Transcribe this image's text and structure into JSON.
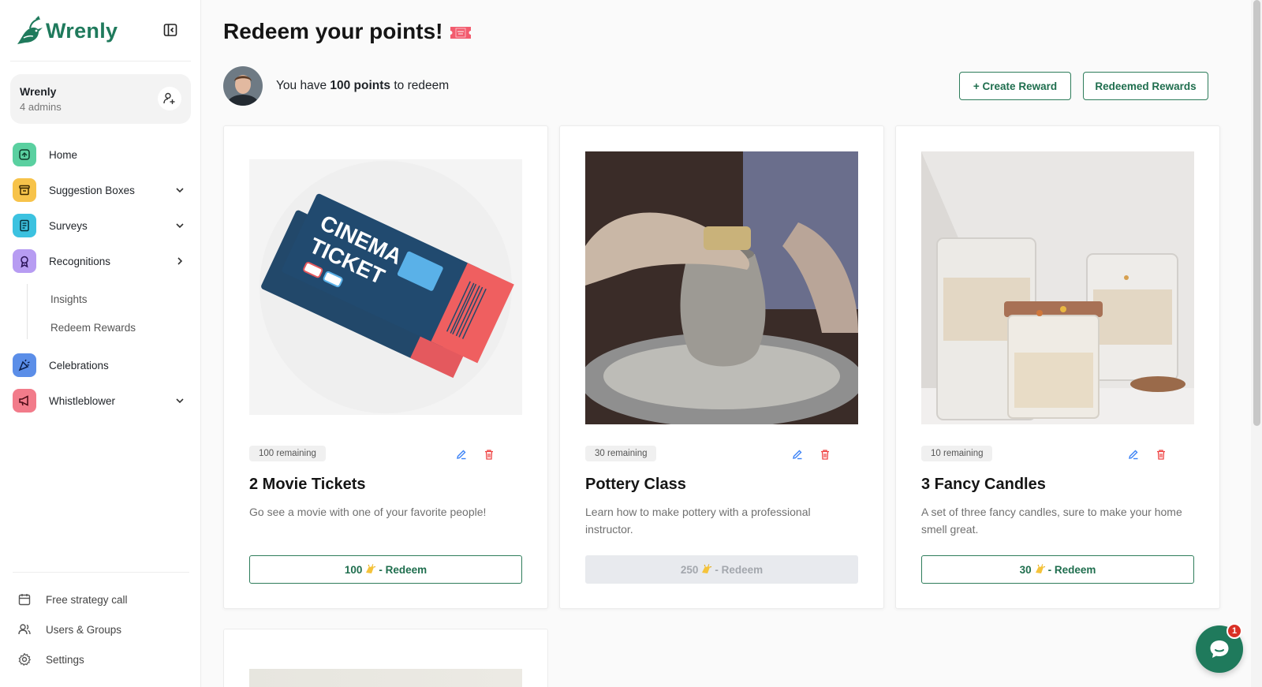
{
  "brand": {
    "name": "Wrenly",
    "color": "#1f7a5c"
  },
  "workspace": {
    "name": "Wrenly",
    "subtitle": "4 admins"
  },
  "nav": {
    "home": "Home",
    "suggestion_boxes": "Suggestion Boxes",
    "surveys": "Surveys",
    "recognitions": "Recognitions",
    "recognitions_sub": [
      "Insights",
      "Redeem Rewards"
    ],
    "celebrations": "Celebrations",
    "whistleblower": "Whistleblower"
  },
  "footer_nav": {
    "strategy_call": "Free strategy call",
    "users_groups": "Users & Groups",
    "settings": "Settings"
  },
  "header": {
    "title": "Redeem your points!",
    "points_prefix": "You have ",
    "points_value": "100 points",
    "points_suffix": " to redeem",
    "create_reward": "+ Create Reward",
    "redeemed_rewards": "Redeemed Rewards"
  },
  "rewards": [
    {
      "remaining": "100 remaining",
      "title": "2 Movie Tickets",
      "description": "Go see a movie with one of your favorite people!",
      "cost": "100",
      "redeem_label": "- Redeem",
      "enabled": true
    },
    {
      "remaining": "30 remaining",
      "title": "Pottery Class",
      "description": "Learn how to make pottery with a professional instructor.",
      "cost": "250",
      "redeem_label": "- Redeem",
      "enabled": false
    },
    {
      "remaining": "10 remaining",
      "title": "3 Fancy Candles",
      "description": "A set of three fancy candles, sure to make your home smell great.",
      "cost": "30",
      "redeem_label": "- Redeem",
      "enabled": true
    }
  ],
  "chat": {
    "unread": "1"
  }
}
